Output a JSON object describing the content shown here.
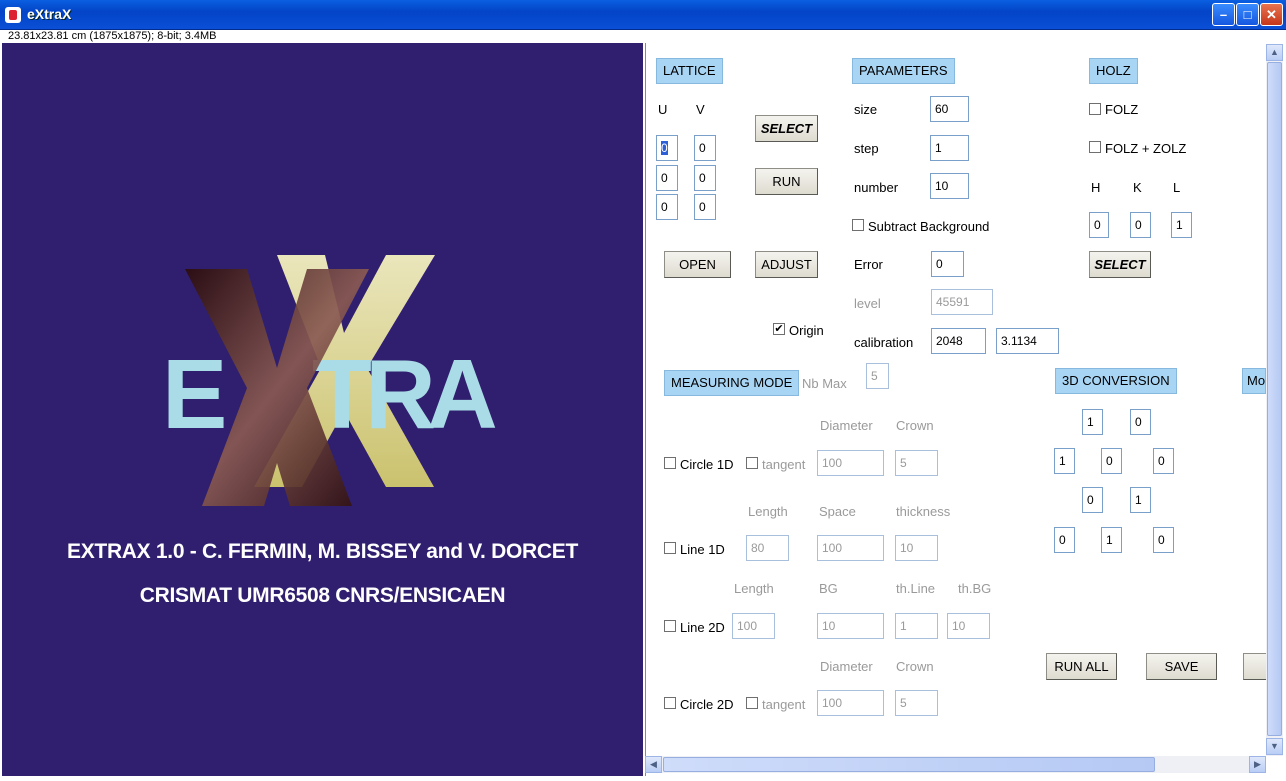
{
  "window": {
    "title": "eXtraX",
    "info": "23.81x23.81 cm (1875x1875); 8-bit; 3.4MB"
  },
  "image": {
    "logo_letters": [
      "E",
      "X",
      "T",
      "R",
      "A"
    ],
    "credit_line1": "EXTRAX 1.0 - C. FERMIN, M. BISSEY and V. DORCET",
    "credit_line2": "CRISMAT UMR6508 CNRS/ENSICAEN"
  },
  "lattice": {
    "header": "LATTICE",
    "u_label": "U",
    "v_label": "V",
    "rows": [
      [
        "0",
        "0"
      ],
      [
        "0",
        "0"
      ],
      [
        "0",
        "0"
      ]
    ],
    "select": "SELECT",
    "run": "RUN",
    "open": "OPEN",
    "adjust": "ADJUST",
    "origin_label": "Origin",
    "origin_checked": true
  },
  "parameters": {
    "header": "PARAMETERS",
    "size_label": "size",
    "size": "60",
    "step_label": "step",
    "step": "1",
    "number_label": "number",
    "number": "10",
    "subtract_label": "Subtract Background",
    "error_label": "Error",
    "error": "0",
    "level_label": "level",
    "level": "45591",
    "calibration_label": "calibration",
    "calibration_a": "2048",
    "calibration_b": "3.1134"
  },
  "holz": {
    "header": "HOLZ",
    "folz": "FOLZ",
    "folz_zolz": "FOLZ + ZOLZ",
    "h_label": "H",
    "k_label": "K",
    "l_label": "L",
    "h": "0",
    "k": "0",
    "l": "1",
    "select": "SELECT"
  },
  "measuring": {
    "header": "MEASURING MODE",
    "nbmax_label": "Nb Max",
    "nbmax": "5",
    "diameter_label": "Diameter",
    "crown_label": "Crown",
    "circle1d": "Circle 1D",
    "tangent": "tangent",
    "c1_diameter": "100",
    "c1_crown": "5",
    "length_label": "Length",
    "space_label": "Space",
    "thickness_label": "thickness",
    "line1d": "Line 1D",
    "l1_length": "80",
    "l1_space": "100",
    "l1_thickness": "10",
    "bg_label": "BG",
    "thline_label": "th.Line",
    "thbg_label": "th.BG",
    "line2d": "Line 2D",
    "l2_length": "100",
    "l2_bg": "10",
    "l2_thline": "1",
    "l2_thbg": "10",
    "circle2d": "Circle 2D",
    "c2_diameter": "100",
    "c2_crown": "5"
  },
  "conversion": {
    "header": "3D CONVERSION",
    "r1": [
      "1",
      "0"
    ],
    "r2": [
      "1",
      "0",
      "0"
    ],
    "r3": [
      "0",
      "1"
    ],
    "r4": [
      "0",
      "1",
      "0"
    ],
    "run_all": "RUN ALL",
    "save": "SAVE",
    "next_tab_partial": "Mo"
  },
  "colors": {
    "background": "#301f6e",
    "header": "#a9d5f5"
  }
}
